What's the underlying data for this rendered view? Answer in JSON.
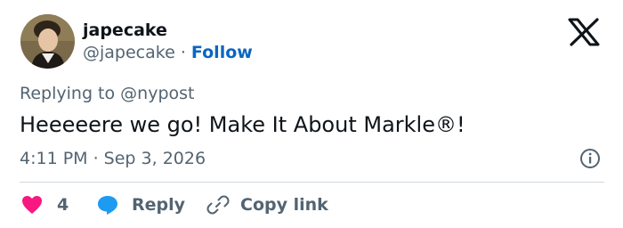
{
  "author": {
    "display_name": "japecake",
    "handle": "@japecake",
    "separator": "·",
    "follow_label": "Follow",
    "avatar": "portrait-avatar"
  },
  "brand": {
    "icon": "x-logo-icon"
  },
  "tweet": {
    "replying_to": "Replying to @nypost",
    "text": "Heeeeere we go! Make It About Markle®!",
    "timestamp": "4:11 PM · Sep 3, 2026"
  },
  "actions": {
    "like": {
      "icon": "heart-icon",
      "count": "4",
      "color": "#f91880"
    },
    "reply": {
      "icon": "speech-bubble-icon",
      "label": "Reply",
      "color": "#1d9bf0"
    },
    "copy": {
      "icon": "link-icon",
      "label": "Copy link"
    }
  },
  "info_icon": "info-icon",
  "colors": {
    "text": "#0f1419",
    "secondary": "#536471",
    "follow": "#0a66c2",
    "divider": "#cfd9de"
  }
}
